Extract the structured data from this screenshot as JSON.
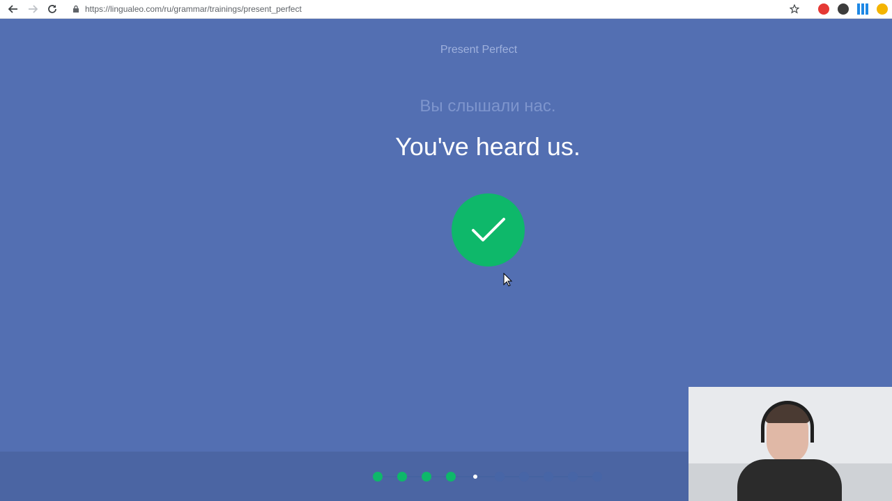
{
  "browser": {
    "url": "https://lingualeo.com/ru/grammar/trainings/present_perfect",
    "extensions": [
      "adblock-icon",
      "k-icon",
      "apps-grid-icon",
      "puzzle-icon"
    ]
  },
  "training": {
    "section_title": "Present Perfect",
    "translation": "Вы слышали нас.",
    "sentence": "You've heard us.",
    "result": "correct"
  },
  "progress": {
    "total": 10,
    "completed": 4,
    "current_index": 5
  },
  "colors": {
    "background": "#536fb2",
    "footer": "#4b65a3",
    "success": "#0eb86a"
  }
}
